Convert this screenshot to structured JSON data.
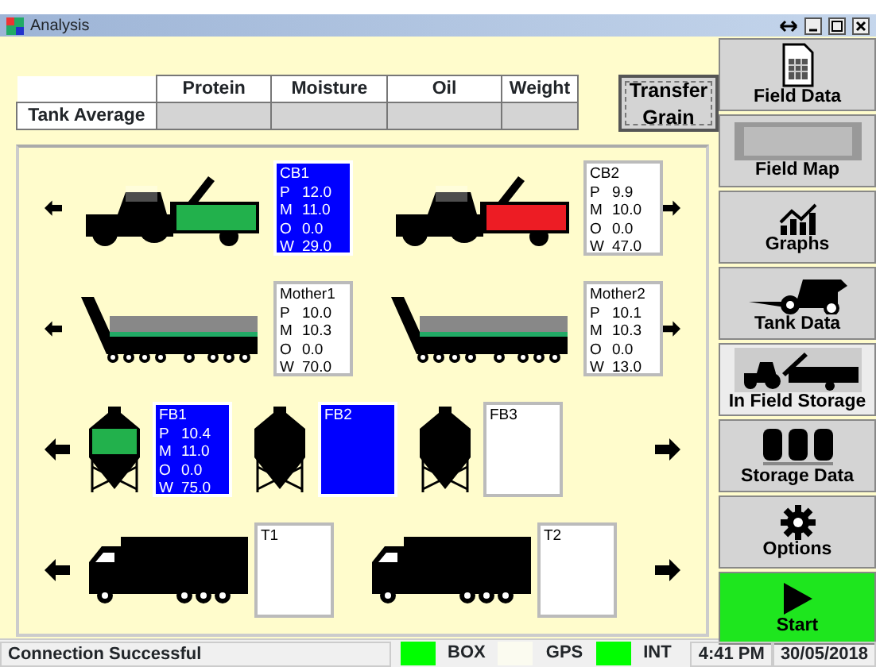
{
  "window": {
    "title": "Analysis"
  },
  "tank_average": {
    "label": "Tank Average",
    "columns": [
      "Protein",
      "Moisture",
      "Oil",
      "Weight"
    ]
  },
  "transfer_button": {
    "label_lines": [
      "Transfer",
      "Grain"
    ]
  },
  "rows": [
    {
      "kind": "cart",
      "items": [
        {
          "name": "CB1",
          "selected": true,
          "color": "#22b14c",
          "readings": [
            {
              "label": "P",
              "value": "12.0"
            },
            {
              "label": "M",
              "value": "11.0"
            },
            {
              "label": "O",
              "value": "0.0"
            },
            {
              "label": "W",
              "value": "29.0"
            }
          ]
        },
        {
          "name": "CB2",
          "selected": false,
          "color": "#ed1c24",
          "readings": [
            {
              "label": "P",
              "value": "9.9"
            },
            {
              "label": "M",
              "value": "10.0"
            },
            {
              "label": "O",
              "value": "0.0"
            },
            {
              "label": "W",
              "value": "47.0"
            }
          ]
        }
      ]
    },
    {
      "kind": "mother",
      "items": [
        {
          "name": "Mother1",
          "selected": false,
          "readings": [
            {
              "label": "P",
              "value": "10.0"
            },
            {
              "label": "M",
              "value": "10.3"
            },
            {
              "label": "O",
              "value": "0.0"
            },
            {
              "label": "W",
              "value": "70.0"
            }
          ]
        },
        {
          "name": "Mother2",
          "selected": false,
          "readings": [
            {
              "label": "P",
              "value": "10.1"
            },
            {
              "label": "M",
              "value": "10.3"
            },
            {
              "label": "O",
              "value": "0.0"
            },
            {
              "label": "W",
              "value": "13.0"
            }
          ]
        }
      ]
    },
    {
      "kind": "bin",
      "items": [
        {
          "name": "FB1",
          "selected": true,
          "color": "#22b14c",
          "readings": [
            {
              "label": "P",
              "value": "10.4"
            },
            {
              "label": "M",
              "value": "11.0"
            },
            {
              "label": "O",
              "value": "0.0"
            },
            {
              "label": "W",
              "value": "75.0"
            }
          ]
        },
        {
          "name": "FB2",
          "selected": true
        },
        {
          "name": "FB3",
          "selected": false
        }
      ]
    },
    {
      "kind": "truck",
      "items": [
        {
          "name": "T1",
          "selected": false
        },
        {
          "name": "T2",
          "selected": false
        }
      ]
    }
  ],
  "sidebar": {
    "items": [
      {
        "label": "Field Data",
        "kind": "field-data",
        "selected": false
      },
      {
        "label": "Field Map",
        "kind": "field-map",
        "selected": false
      },
      {
        "label": "Graphs",
        "kind": "graphs",
        "selected": false
      },
      {
        "label": "Tank Data",
        "kind": "tank-data",
        "selected": false
      },
      {
        "label": "In Field Storage",
        "kind": "in-field-storage",
        "selected": true
      },
      {
        "label": "Storage Data",
        "kind": "storage-data",
        "selected": false
      },
      {
        "label": "Options",
        "kind": "options",
        "selected": false
      },
      {
        "label": "Start",
        "kind": "start",
        "selected": false
      }
    ]
  },
  "status_bar": {
    "message": "Connection Successful",
    "indicators": [
      {
        "label": "BOX",
        "on": true
      },
      {
        "label": "GPS",
        "on": false
      },
      {
        "label": "INT",
        "on": true
      }
    ],
    "time": "4:41 PM",
    "date": "30/05/2018"
  }
}
